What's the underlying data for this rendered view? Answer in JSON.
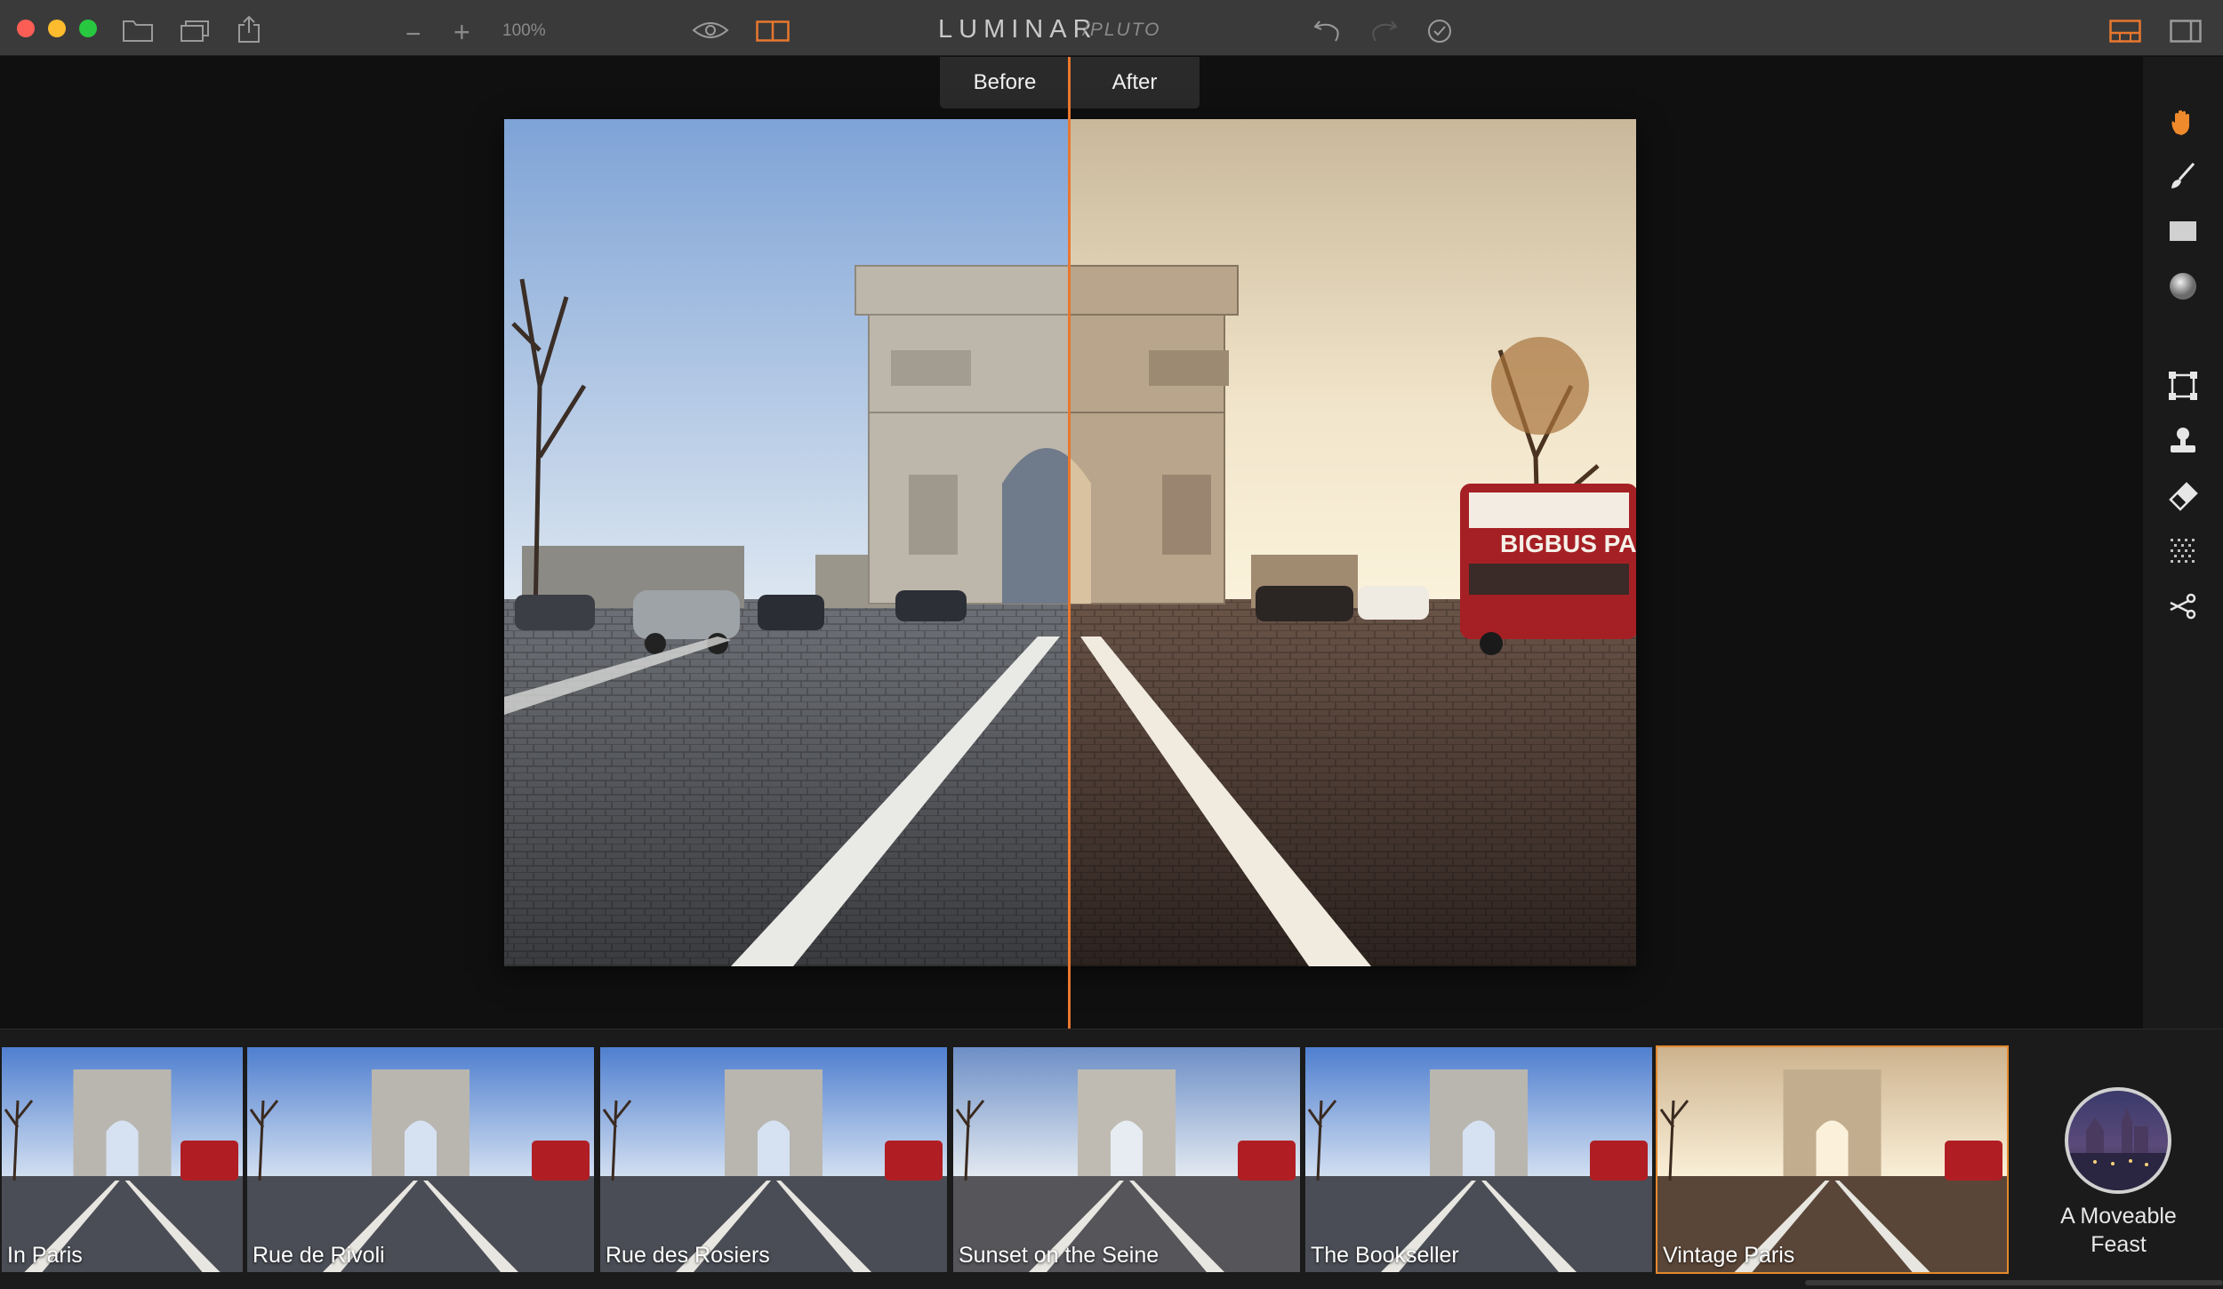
{
  "window": {
    "brand_main": "LUMINAR",
    "brand_sub": "/PLUTO",
    "zoom_level": "100%",
    "accent_color": "#e8772e"
  },
  "toolbar": {
    "left_icons": [
      "open-folder-icon",
      "batch-stack-icon",
      "share-export-icon"
    ],
    "zoom_out": "−",
    "zoom_in": "+",
    "center_icons": [
      "preview-eye-icon",
      "compare-split-icon"
    ],
    "history_icons": [
      "undo-icon",
      "redo-icon",
      "history-check-icon"
    ],
    "right_icons": [
      "layout-filmstrip-icon",
      "sidebar-toggle-icon"
    ]
  },
  "compare": {
    "before_label": "Before",
    "after_label": "After"
  },
  "tools": [
    "pan-hand-icon",
    "brush-icon",
    "gradient-rect-icon",
    "radial-mask-icon",
    "crop-transform-icon",
    "clone-stamp-icon",
    "erase-icon",
    "noise-texture-icon",
    "cut-scissors-icon"
  ],
  "presets": [
    {
      "label": "In Paris",
      "tone": "cool",
      "active": false
    },
    {
      "label": "Rue de Rivoli",
      "tone": "cool",
      "active": false
    },
    {
      "label": "Rue des Rosiers",
      "tone": "cool",
      "active": false
    },
    {
      "label": "Sunset on the Seine",
      "tone": "neutral",
      "active": false
    },
    {
      "label": "The Bookseller",
      "tone": "cool",
      "active": false
    },
    {
      "label": "Vintage Paris",
      "tone": "warm",
      "active": true
    }
  ],
  "collection": {
    "label_line1": "A Moveable",
    "label_line2": "Feast"
  }
}
